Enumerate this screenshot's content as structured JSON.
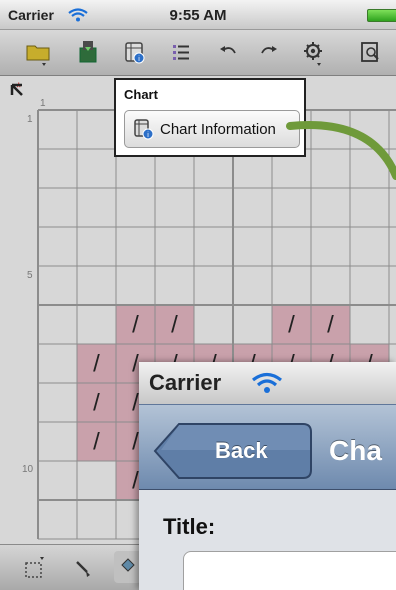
{
  "status_bar": {
    "carrier": "Carrier",
    "time": "9:55 AM"
  },
  "toolbar": {
    "buttons": [
      {
        "icon": "folder-icon"
      },
      {
        "icon": "save-icon"
      },
      {
        "icon": "chart-info-icon"
      },
      {
        "icon": "list-icon"
      },
      {
        "icon": "undo-icon"
      },
      {
        "icon": "redo-icon"
      },
      {
        "icon": "settings-icon"
      },
      {
        "icon": "preview-icon"
      }
    ]
  },
  "chart": {
    "corner_marker": "*",
    "column_numbers": [
      "1"
    ],
    "row_numbers": [
      "1",
      "5",
      "10"
    ],
    "fill_color": "#c9a1ab",
    "grid_color": "#8c8c8c",
    "stitch_symbol": "/",
    "filled_cells": [
      [
        5,
        2
      ],
      [
        5,
        3
      ],
      [
        5,
        6
      ],
      [
        5,
        7
      ],
      [
        6,
        1
      ],
      [
        6,
        2
      ],
      [
        6,
        3
      ],
      [
        6,
        4
      ],
      [
        6,
        5
      ],
      [
        6,
        6
      ],
      [
        6,
        7
      ],
      [
        6,
        8
      ],
      [
        7,
        1
      ],
      [
        7,
        2
      ],
      [
        7,
        3
      ],
      [
        7,
        4
      ],
      [
        7,
        5
      ],
      [
        7,
        6
      ],
      [
        7,
        7
      ],
      [
        7,
        8
      ],
      [
        8,
        1
      ],
      [
        8,
        2
      ],
      [
        8,
        3
      ],
      [
        8,
        4
      ],
      [
        8,
        5
      ],
      [
        8,
        6
      ],
      [
        8,
        7
      ],
      [
        8,
        8
      ],
      [
        9,
        2
      ],
      [
        9,
        3
      ]
    ]
  },
  "popover": {
    "title": "Chart",
    "button_label": "Chart Information"
  },
  "bottom_bar": {
    "tools": [
      {
        "icon": "selection-icon"
      },
      {
        "icon": "brush-icon"
      },
      {
        "icon": "eraser-icon"
      }
    ]
  },
  "overlay": {
    "carrier": "Carrier",
    "back_label": "Back",
    "nav_title": "Cha",
    "field_label": "Title:",
    "nav_color": "#7f99ba",
    "accent_arrow_color": "#6f9a3a"
  }
}
